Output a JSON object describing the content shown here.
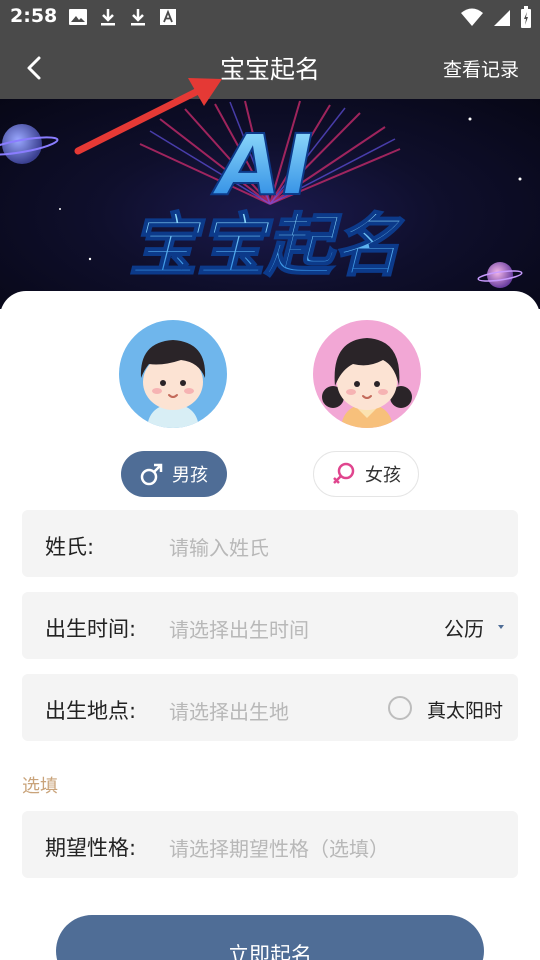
{
  "status_bar": {
    "time": "2:58",
    "icons": [
      "image-icon",
      "download-icon",
      "download-icon",
      "font-icon",
      "wifi-icon",
      "signal-icon",
      "battery-icon"
    ]
  },
  "app_bar": {
    "title": "宝宝起名",
    "records_label": "查看记录"
  },
  "banner": {
    "line1": "AI",
    "line2": "宝宝起名"
  },
  "gender": {
    "boy_label": "男孩",
    "girl_label": "女孩",
    "selected": "boy"
  },
  "form": {
    "surname": {
      "label": "姓氏:",
      "placeholder": "请输入姓氏"
    },
    "birth_time": {
      "label": "出生时间:",
      "placeholder": "请选择出生时间",
      "calendar": "公历"
    },
    "birth_place": {
      "label": "出生地点:",
      "placeholder": "请选择出生地",
      "solar_time": "真太阳时"
    },
    "optional_label": "选填",
    "personality": {
      "label": "期望性格:",
      "placeholder": "请选择期望性格（选填）"
    }
  },
  "submit_label": "立即起名",
  "colors": {
    "bar": "#4a4a4a",
    "accent": "#4f6d96",
    "optional": "#c9a37a",
    "annotation": "#e53935"
  }
}
